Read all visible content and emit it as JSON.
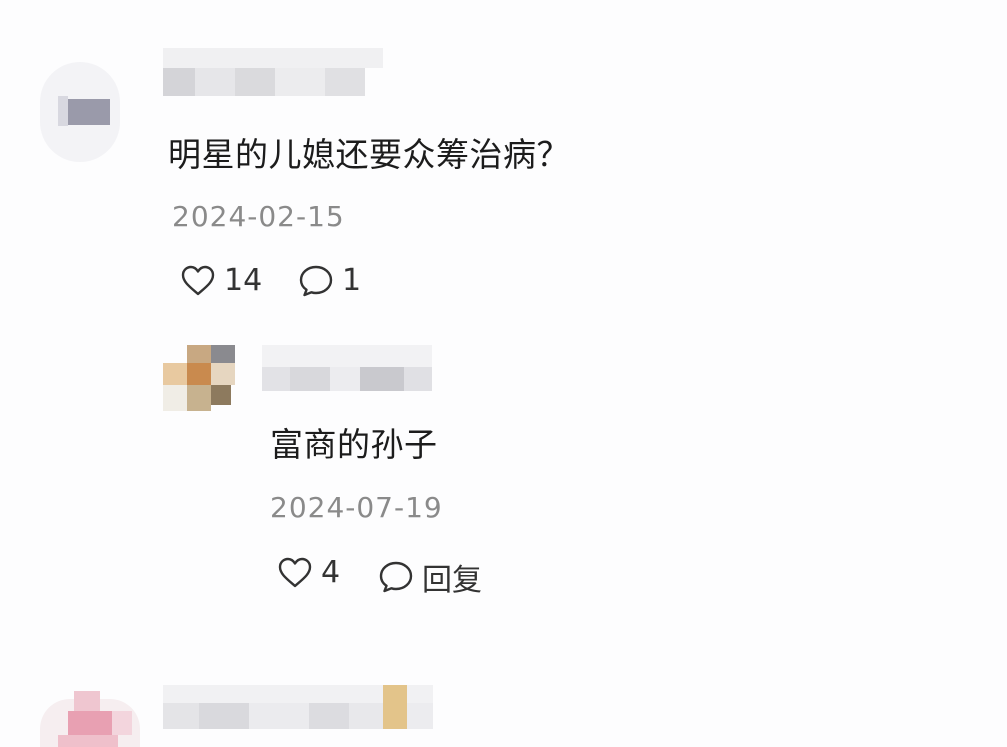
{
  "comments": [
    {
      "text": "明星的儿媳还要众筹治病？",
      "date": "2024-02-15",
      "likes": "14",
      "replies": "1"
    },
    {
      "text": "富商的孙子",
      "date": "2024-07-19",
      "likes": "4",
      "reply_label": "回复"
    }
  ],
  "colors": {
    "text": "#1c1c1c",
    "date": "#8a8a8a",
    "icon": "#333333"
  }
}
